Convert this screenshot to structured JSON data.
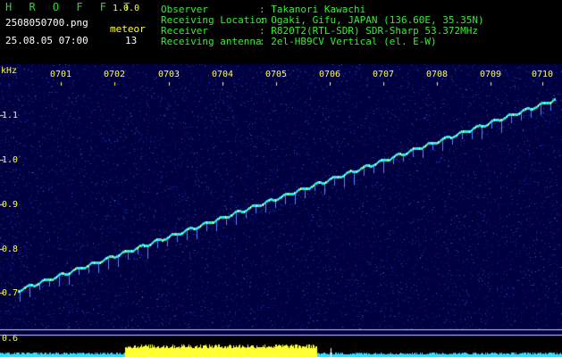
{
  "header": {
    "app_name": "H R O F F T",
    "version": "1.0.0",
    "filename": "2508050700.png",
    "datetime": "25.08.05 07:00",
    "meteor_label": "meteor",
    "meteor_count": "13",
    "info": [
      {
        "label": "Observer",
        "value": ": Takanori Kawachi"
      },
      {
        "label": "Receiving Location",
        "value": ": Ogaki, Gifu, JAPAN (136.60E, 35.35N)"
      },
      {
        "label": "Receiver",
        "value": ": R820T2(RTL-SDR) SDR-Sharp 53.372MHz"
      },
      {
        "label": "Receiving antenna",
        "value": ": 2el-HB9CV Vertical (el. E-W)"
      }
    ]
  },
  "axis": {
    "unit": "kHz",
    "time_ticks": [
      "0701",
      "0702",
      "0703",
      "0704",
      "0705",
      "0706",
      "0707",
      "0708",
      "0709",
      "0710"
    ],
    "freq_ticks": [
      "1.1",
      "1.0",
      "0.9",
      "0.8",
      "0.7"
    ],
    "lower_tick": "0.6"
  },
  "colors": {
    "background": "#000050",
    "trace": "#33ddff",
    "signal": "#ffff33",
    "label": "#ffff33",
    "header_green": "#33ee33"
  }
}
